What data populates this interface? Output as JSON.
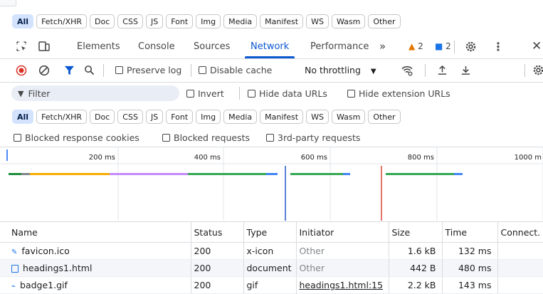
{
  "top_filters": [
    "All",
    "Fetch/XHR",
    "Doc",
    "CSS",
    "JS",
    "Font",
    "Img",
    "Media",
    "Manifest",
    "WS",
    "Wasm",
    "Other"
  ],
  "tabs": {
    "elements": "Elements",
    "console": "Console",
    "sources": "Sources",
    "network": "Network",
    "performance": "Performance",
    "more": "»",
    "warnings": "2",
    "messages": "2"
  },
  "toolbar": {
    "preserve_log": "Preserve log",
    "disable_cache": "Disable cache",
    "throttling": "No throttling"
  },
  "filter": {
    "placeholder": "Filter",
    "invert": "Invert",
    "hide_data_urls": "Hide data URLs",
    "hide_extension_urls": "Hide extension URLs"
  },
  "type_filters": [
    "All",
    "Fetch/XHR",
    "Doc",
    "CSS",
    "JS",
    "Font",
    "Img",
    "Media",
    "Manifest",
    "WS",
    "Wasm",
    "Other"
  ],
  "blocked": {
    "cookies": "Blocked response cookies",
    "requests": "Blocked requests",
    "third_party": "3rd-party requests"
  },
  "timeline": {
    "ticks": [
      "200 ms",
      "400 ms",
      "600 ms",
      "800 ms",
      "1000 m"
    ],
    "max_ms": 1000
  },
  "table": {
    "headers": {
      "name": "Name",
      "status": "Status",
      "type": "Type",
      "initiator": "Initiator",
      "size": "Size",
      "time": "Time",
      "connect": "Connect."
    },
    "rows": [
      {
        "name": "favicon.ico",
        "status": "200",
        "type": "x-icon",
        "initiator": "Other",
        "size": "1.6 kB",
        "time": "132 ms",
        "icon": "favicon-icon"
      },
      {
        "name": "headings1.html",
        "status": "200",
        "type": "document",
        "initiator": "Other",
        "size": "442 B",
        "time": "480 ms",
        "icon": "document-icon"
      },
      {
        "name": "badge1.gif",
        "status": "200",
        "type": "gif",
        "initiator": "headings1.html:15",
        "size": "2.2 kB",
        "time": "143 ms",
        "icon": "image-icon"
      }
    ]
  },
  "colors": {
    "accent": "#0b57d0",
    "active_chip": "#d3e3fd",
    "record": "#d93025",
    "warning": "#e37400",
    "message": "#1a73e8"
  }
}
